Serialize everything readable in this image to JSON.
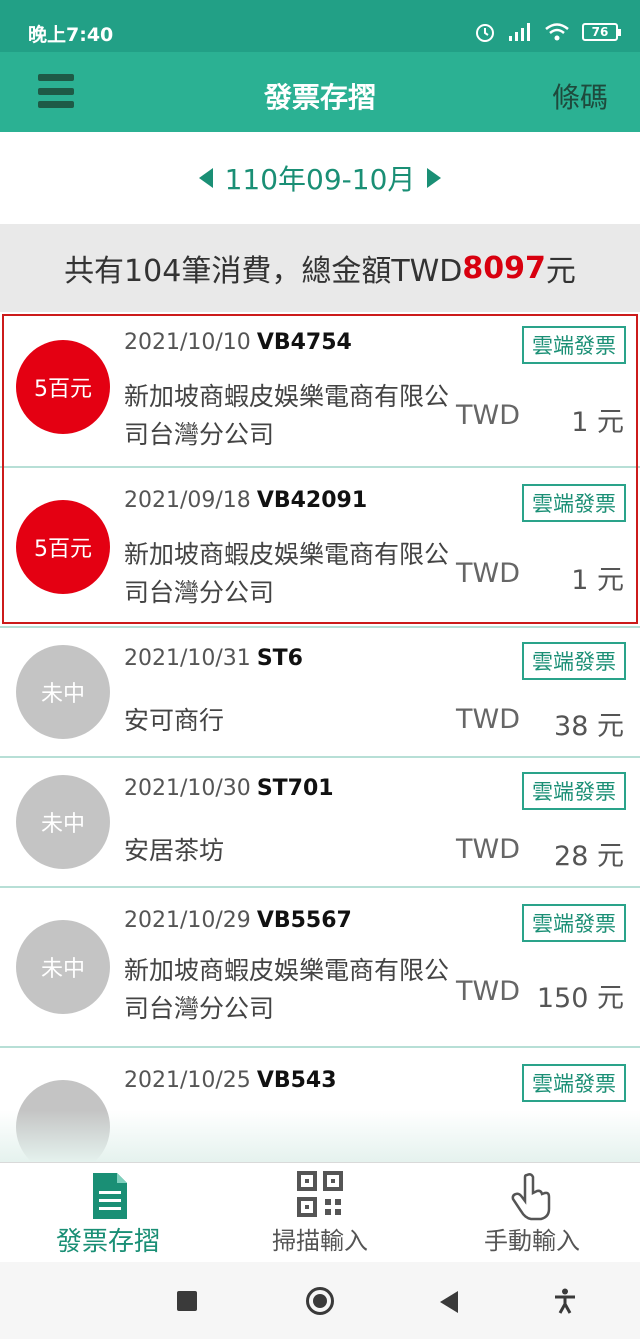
{
  "status_bar": {
    "time": "晚上7:40",
    "battery": "76"
  },
  "app_bar": {
    "title": "發票存摺",
    "barcode_label": "條碼"
  },
  "period": {
    "label": "110年09-10月"
  },
  "summary": {
    "prefix": "共有104筆消費，總金額TWD",
    "amount": "8097",
    "suffix": "元"
  },
  "invoices": [
    {
      "badge": "5百元",
      "date": "2021/10/10",
      "number": "VB4754",
      "merchant": "新加坡商蝦皮娛樂電商有限公司台灣分公司",
      "tag": "雲端發票",
      "currency": "TWD",
      "amount": "1 元"
    },
    {
      "badge": "5百元",
      "date": "2021/09/18",
      "number": "VB42091",
      "merchant": "新加坡商蝦皮娛樂電商有限公司台灣分公司",
      "tag": "雲端發票",
      "currency": "TWD",
      "amount": "1 元"
    },
    {
      "badge": "未中",
      "date": "2021/10/31",
      "number": "ST6",
      "merchant": "安可商行",
      "tag": "雲端發票",
      "currency": "TWD",
      "amount": "38 元"
    },
    {
      "badge": "未中",
      "date": "2021/10/30",
      "number": "ST701",
      "merchant": "安居茶坊",
      "tag": "雲端發票",
      "currency": "TWD",
      "amount": "28 元"
    },
    {
      "badge": "未中",
      "date": "2021/10/29",
      "number": "VB5567",
      "merchant": "新加坡商蝦皮娛樂電商有限公司台灣分公司",
      "tag": "雲端發票",
      "currency": "TWD",
      "amount": "150 元"
    },
    {
      "badge": "",
      "date": "2021/10/25",
      "number": "VB543",
      "merchant": "",
      "tag": "雲端發票",
      "currency": "",
      "amount": ""
    }
  ],
  "bottom_nav": [
    {
      "label": "發票存摺",
      "icon": "document-icon"
    },
    {
      "label": "掃描輸入",
      "icon": "qr-code-icon"
    },
    {
      "label": "手動輸入",
      "icon": "hand-pointer-icon"
    }
  ],
  "colors": {
    "primary": "#2bb193",
    "status_bar": "#22a086",
    "win_badge": "#e40012",
    "lose_badge": "#c4c4c4",
    "amount_red": "#d8000f"
  }
}
